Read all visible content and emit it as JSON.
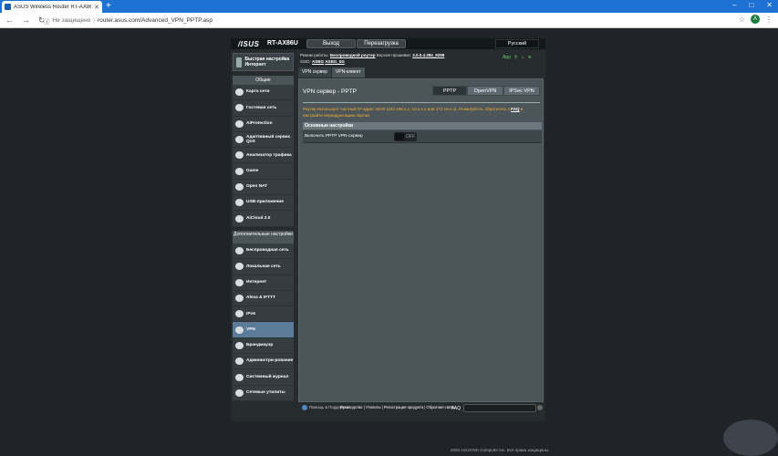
{
  "browser": {
    "tab_title": "ASUS Wireless Router RT-AX86U",
    "new_tab": "+",
    "security_label": "Не защищено",
    "url": "router.asus.com/Advanced_VPN_PPTP.asp",
    "avatar_letter": "A",
    "window_controls": [
      "–",
      "□",
      "✕"
    ]
  },
  "router": {
    "logo": "/ISUS",
    "model": "RT-AX86U",
    "logout": "Выход",
    "reboot": "Перезагрузка",
    "language": "Русский",
    "quick_setup": "Быстрая настройка Интернет",
    "mode_label": "Режим работы:",
    "mode_value": "Беспроводной роутер",
    "firmware_label": "Версия прошивки:",
    "firmware_value": "3.0.0.4.384_9298",
    "ssid_label": "SSID:",
    "ssid_values": [
      "ASBG",
      "ASBG_5G"
    ],
    "status_app": "App"
  },
  "sidebar": {
    "general_title": "Общие",
    "general_items": [
      "Карта сети",
      "Гостевая сеть",
      "AiProtection",
      "Адаптивный сервис QoS",
      "Анализатор трафика",
      "Game",
      "Open NAT",
      "USB-приложение",
      "AiCloud 2.0"
    ],
    "advanced_title": "Дополнительные настройки",
    "advanced_items": [
      "Беспроводная сеть",
      "Локальная сеть",
      "Интернет",
      "Alexa & IFTTT",
      "IPv6",
      "VPN",
      "Брандмауэр",
      "Администри-рование",
      "Системный журнал",
      "Сетевые утилиты"
    ]
  },
  "content": {
    "tabs": [
      "VPN сервер",
      "VPN-клиент"
    ],
    "title": "VPN сервер - PPTP",
    "protocols": [
      "PPTP",
      "OpenVPN",
      "IPSec VPN"
    ],
    "notice": "Роутер использует частный IP-адрес WAN (192.168.x.x, 10.x.x.x или 172.16.x.x). Пожалуйста, обратитесь к",
    "notice_link": "FAQ",
    "notice_end": "и настройте переадресацию портов.",
    "section": "Основные настройки",
    "enable_label": "Включить PPTP VPN-сервер",
    "toggle_state": "OFF"
  },
  "footer": {
    "help": "Помощь & Поддержка",
    "links": "Руководство | Утилиты | Регистрация продукта | Обратная связь",
    "faq": "FAQ",
    "copyright": "2020 ASUSTeK Computer Inc. Все права защищены."
  }
}
